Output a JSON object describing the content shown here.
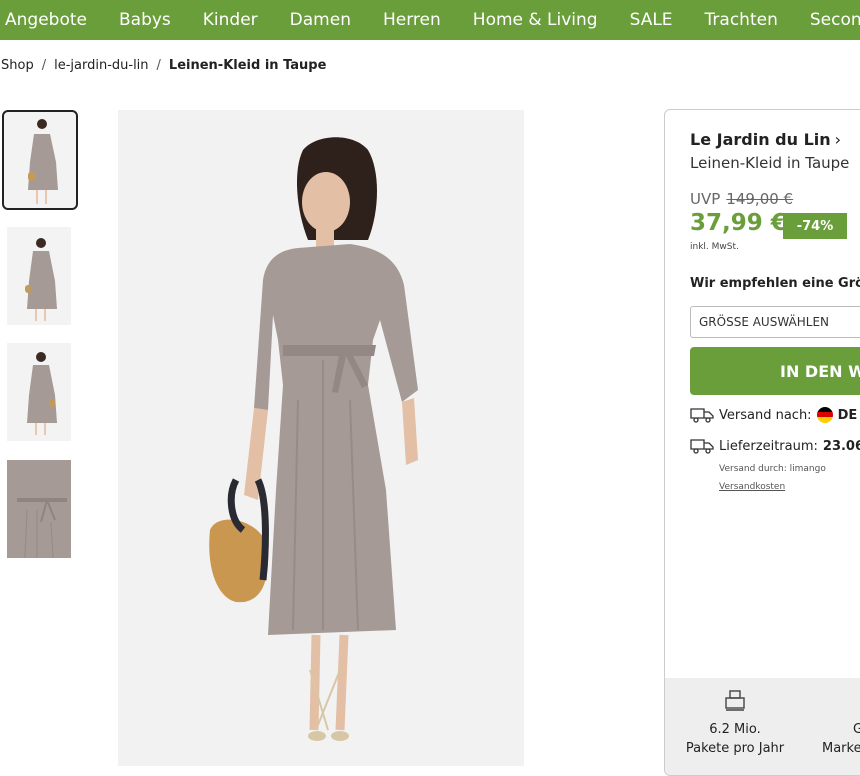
{
  "nav": {
    "items": [
      "Angebote",
      "Babys",
      "Kinder",
      "Damen",
      "Herren",
      "Home & Living",
      "SALE",
      "Trachten",
      "Second"
    ]
  },
  "breadcrumb": {
    "items": [
      "Shop",
      "le-jardin-du-lin"
    ],
    "current": "Leinen-Kleid in Taupe"
  },
  "product": {
    "brand": "Le Jardin du Lin",
    "name": "Leinen-Kleid in Taupe",
    "uvp_label": "UVP",
    "uvp_price": "149,00 €",
    "price": "37,99 €",
    "discount": "-74%",
    "tax_note": "inkl. MwSt.",
    "size_recommend": "Wir empfehlen eine Größe",
    "size_select": "GRÖSSE AUSWÄHLEN",
    "cart_button": "IN DEN W",
    "shipping_label": "Versand nach:",
    "shipping_country": "DE /",
    "delivery_label": "Lieferzeitraum:",
    "delivery_value": "23.06.",
    "shipped_by": "Versand durch: limango",
    "shipping_costs": "Versandkosten"
  },
  "stats": {
    "packages_value": "6.2 Mio.",
    "packages_label": "Pakete pro Jahr",
    "second_value": "G",
    "second_label": "Marke"
  },
  "colors": {
    "brand_green": "#6a9e3a",
    "dress": "#a59a96"
  }
}
